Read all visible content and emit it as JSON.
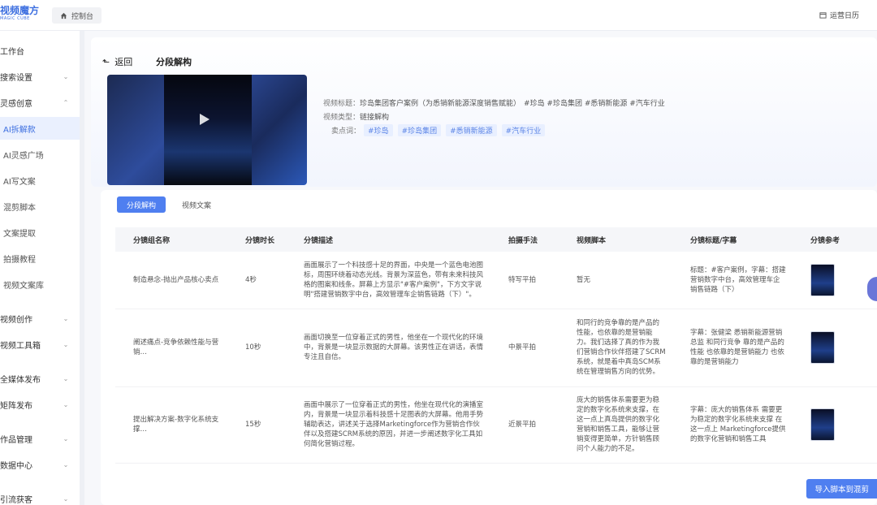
{
  "brand": {
    "name": "视频魔方",
    "sub": "MAGIC CUBE"
  },
  "topbar": {
    "home_tab": "控制台",
    "right_label": "运营日历"
  },
  "sidebar": {
    "items": [
      {
        "label": "工作台",
        "chevron": ""
      },
      {
        "label": "搜索设置",
        "chevron": "⌄"
      },
      {
        "label": "灵感创意",
        "chevron": "⌃"
      },
      {
        "label": "AI拆解款",
        "chevron": "",
        "active": true,
        "sub": true
      },
      {
        "label": "AI灵感广场",
        "chevron": "",
        "sub": true
      },
      {
        "label": "AI写文案",
        "chevron": "",
        "sub": true
      },
      {
        "label": "混剪脚本",
        "chevron": "",
        "sub": true
      },
      {
        "label": "文案提取",
        "chevron": "",
        "sub": true
      },
      {
        "label": "拍摄教程",
        "chevron": "",
        "sub": true
      },
      {
        "label": "视频文案库",
        "chevron": "",
        "sub": true
      },
      {
        "label": "视频创作",
        "chevron": "⌄"
      },
      {
        "label": "视频工具箱",
        "chevron": "⌄"
      },
      {
        "label": "全媒体发布",
        "chevron": "⌄"
      },
      {
        "label": "矩阵发布",
        "chevron": "⌄"
      },
      {
        "label": "作品管理",
        "chevron": "⌄"
      },
      {
        "label": "数据中心",
        "chevron": "⌄"
      },
      {
        "label": "引流获客",
        "chevron": "⌄"
      }
    ]
  },
  "header": {
    "back_label": "返回",
    "title": "分段解构",
    "video_title_key": "视频标题：",
    "video_title_value": "珍岛集团客户案例（为悉销新能源深度销售赋能）",
    "video_title_tags": "#珍岛 #珍岛集团 #悉销新能源 #汽车行业",
    "video_type_key": "视频类型：",
    "video_type_value": "链接解构",
    "selling_key": "卖点词：",
    "selling_tags": [
      "#珍岛",
      "#珍岛集团",
      "#悉销新能源",
      "#汽车行业"
    ]
  },
  "content": {
    "tabs": [
      "分段解构",
      "视频文案"
    ],
    "columns": [
      "分镜组名称",
      "分镜时长",
      "分镜描述",
      "拍摄手法",
      "视频脚本",
      "分镜标题/字幕",
      "分镜参考"
    ],
    "rows": [
      {
        "name": "制造悬念-抛出产品核心卖点",
        "duration": "4秒",
        "desc": "画面展示了一个科技感十足的界面，中央是一个蓝色电池图标，周围环绕着动态光线。背景为深蓝色，带有未来科技风格的图案和线条。屏幕上方显示\"#客户案例\"，下方文字说明\"搭建营销数字中台，高效管理车企销售链路（下）\"。",
        "method": "特写平拍",
        "script": "暂无",
        "subtitle": "标题：#客户案例，字幕：搭建营销数字中台，高效管理车企销售链路（下）"
      },
      {
        "name": "阐述痛点-竞争依赖性能与营销…",
        "duration": "10秒",
        "desc": "画面切换至一位穿着正式的男性，他坐在一个现代化的环境中，背景是一块显示数据的大屏幕。该男性正在讲话，表情专注且自信。",
        "method": "中景平拍",
        "script": "和同行的竞争靠的是产品的性能，也依靠的是营销能力。我们选择了真的作为我们营销合作伙伴搭建了SCRM系统，就是着中真岛SCM系统在管理销售方向的优势。",
        "subtitle": "字幕：张健梁 悉销新能源营销总监 和同行竞争 靠的是产品的性能 也依靠的是营销能力 也依靠的是营销能力"
      },
      {
        "name": "提出解决方案-数字化系统支撑…",
        "duration": "15秒",
        "desc": "画面中展示了一位穿着正式的男性，他坐在现代化的演播室内，背景是一块显示着科技感十足图表的大屏幕。他用手势辅助表达，讲述关于选择Marketingforce作为营销合作伙伴以及搭建SCRM系统的原因，并进一步阐述数字化工具如何简化营销过程。",
        "method": "近景平拍",
        "script": "庞大的销售体系需要更为稳定的数字化系统来支撑，在这一点上真岛提供的数字化营销和销售工具，能够让营销变得更简单，方针销售顾问个人能力的不足。",
        "subtitle": "字幕：庞大的销售体系 需要更为稳定的数字化系统来支撑 在这一点上 Marketingforce提供的数字化营销和销售工具"
      }
    ],
    "import_button": "导入脚本到混剪"
  }
}
